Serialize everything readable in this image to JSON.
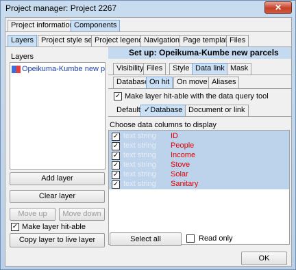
{
  "window": {
    "title": "Project manager: Project 2267",
    "close_glyph": "✕"
  },
  "top_tabs": [
    "Project information",
    "Components"
  ],
  "sub_tabs": [
    "Layers",
    "Project style set",
    "Project legend",
    "Navigation",
    "Page template",
    "Files"
  ],
  "layers_panel": {
    "label": "Layers",
    "items": [
      {
        "name": "Opeikuma-Kumbe new p",
        "icon": "layer-icon"
      }
    ],
    "buttons": {
      "add": "Add layer",
      "clear": "Clear layer",
      "move_up": "Move up",
      "move_down": "Move down",
      "copy_live": "Copy layer to live layer"
    },
    "hitable": {
      "label": "Make layer hit-able",
      "checked": true
    }
  },
  "setup": {
    "heading": "Set up: Opeikuma-Kumbe new parcels",
    "tabs": [
      "Visibility",
      "Files",
      "Style",
      "Data link",
      "Mask"
    ],
    "link_tabs": [
      "Database",
      "On hit",
      "On move",
      "Aliases"
    ],
    "hitable_query": {
      "label": "Make layer hit-able with the data query tool",
      "checked": true
    },
    "source_tabs": [
      "Default",
      "✓Database",
      "Document or link"
    ],
    "columns_label": "Choose data columns to display",
    "columns": [
      {
        "type": "text string",
        "name": "ID",
        "checked": true
      },
      {
        "type": "text string",
        "name": "People",
        "checked": true
      },
      {
        "type": "text string",
        "name": "Income",
        "checked": true
      },
      {
        "type": "text string",
        "name": "Stove",
        "checked": true
      },
      {
        "type": "text string",
        "name": "Solar",
        "checked": true
      },
      {
        "type": "text string",
        "name": "Sanitary",
        "checked": true
      }
    ],
    "select_all": "Select all",
    "read_only": {
      "label": "Read only",
      "checked": false
    }
  },
  "ok_button": "OK",
  "colors": {
    "accent": "#c9e0f7",
    "header_bg": "#c4daf0",
    "row_highlight": "#bdd3ec",
    "column_name": "#e00000"
  }
}
